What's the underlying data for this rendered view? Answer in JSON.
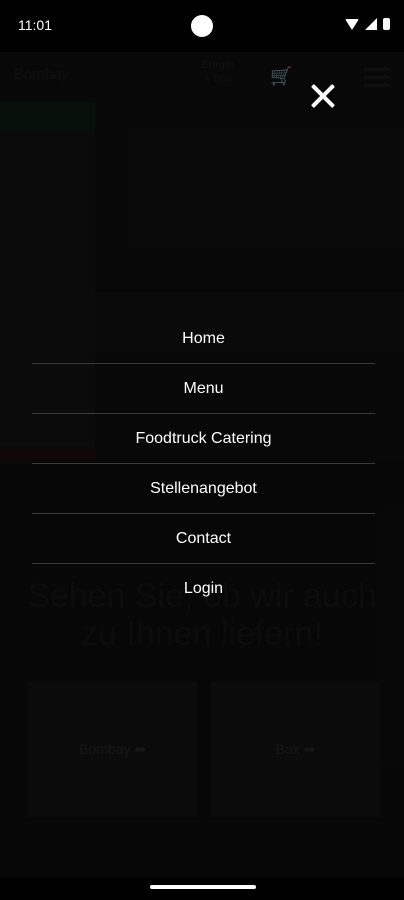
{
  "status_bar": {
    "time": "11:01"
  },
  "site": {
    "brand": "Bombay",
    "address_line1": "Burger",
    "address_line2": "+ Box",
    "cart_icon": "cart-icon"
  },
  "hero": {
    "headline": "Sehen Sie, ob wir auch zu Ihnen liefern!"
  },
  "choices": [
    {
      "label": "Bombay ➡"
    },
    {
      "label": "Box ➡"
    }
  ],
  "menu": {
    "close_icon": "close-icon",
    "items": [
      {
        "label": "Home"
      },
      {
        "label": "Menu"
      },
      {
        "label": "Foodtruck Catering"
      },
      {
        "label": "Stellenangebot"
      },
      {
        "label": "Contact"
      },
      {
        "label": "Login"
      }
    ]
  }
}
